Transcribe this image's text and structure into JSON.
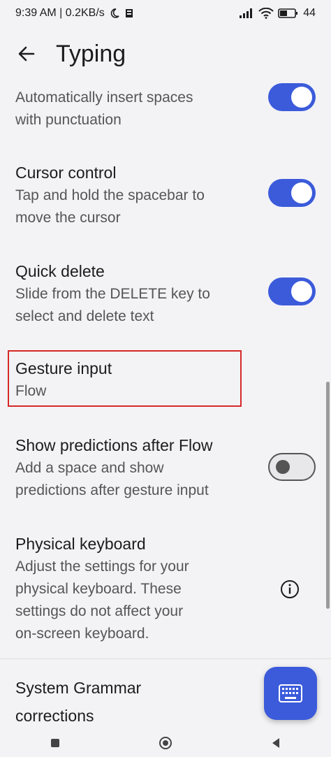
{
  "status": {
    "time_speed": "9:39 AM | 0.2KB/s",
    "battery": "44"
  },
  "header": {
    "title": "Typing"
  },
  "settings": [
    {
      "title": "",
      "desc1": "Automatically insert spaces",
      "desc2": "with punctuation",
      "toggle": "on"
    },
    {
      "title": "Cursor control",
      "desc1": "Tap and hold the spacebar to",
      "desc2": "move the cursor",
      "toggle": "on"
    },
    {
      "title": "Quick delete",
      "desc1": "Slide from the DELETE key to",
      "desc2": "select and delete text",
      "toggle": "on"
    },
    {
      "title": "Gesture input",
      "desc1": "Flow"
    },
    {
      "title": "Show predictions after Flow",
      "desc1": "Add a space and show",
      "desc2": "predictions after gesture input",
      "toggle": "off"
    },
    {
      "title": "Physical keyboard",
      "desc1": "Adjust the settings for your",
      "desc2": "physical keyboard. These",
      "desc3": "settings do not affect your",
      "desc4": "on-screen keyboard."
    },
    {
      "title1": "System Grammar",
      "title2": "corrections"
    }
  ],
  "colors": {
    "accent": "#3b5bdb",
    "highlight": "#d62828"
  },
  "icons": {
    "back": "arrow-left-icon",
    "info": "info-icon",
    "fab": "keyboard-icon"
  }
}
